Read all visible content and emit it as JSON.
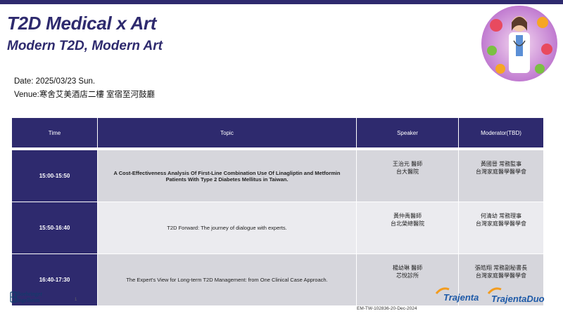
{
  "header": {
    "title": "T2D Medical x Art",
    "subtitle": "Modern T2D, Modern Art"
  },
  "event": {
    "date": "Date: 2025/03/23 Sun.",
    "venue": "Venue:寒舍艾美酒店二樓 室宿至河鼓廳"
  },
  "table": {
    "columns": [
      "Time",
      "Topic",
      "Speaker",
      "Moderator(TBD)"
    ],
    "rows": [
      {
        "time": "15:00-15:50",
        "topic": "A Cost-Effectiveness Analysis Of First-Line Combination Use Of Linagliptin and Metformin Patients With Type 2 Diabetes Mellitus in Taiwan.",
        "speaker_name": "王治元 醫師",
        "speaker_org": "台大醫院",
        "moderator_name": "黃國晉 常務監事",
        "moderator_org": "台灣家庭醫學醫學會"
      },
      {
        "time": "15:50-16:40",
        "topic": "T2D Forward: The journey of dialogue with experts.",
        "speaker_name": "黃仲禹醫師",
        "speaker_org": "台北榮總醫院",
        "moderator_name": "何清幼 常務理事",
        "moderator_org": "台灣家庭醫學醫學會"
      },
      {
        "time": "16:40-17:30",
        "topic": "The Expert's View for Long-term T2D Management: from One Clinical Case Approach.",
        "speaker_name": "楊幼琳 醫師",
        "speaker_org": "芯悅診所",
        "moderator_name": "張皓翔 常務副秘書長",
        "moderator_org": "台灣家庭醫學醫學會"
      }
    ]
  },
  "footer": {
    "company_line1": "Boehringer",
    "company_line2": "Ingelheim",
    "page_number": "1",
    "doc_number": "EM-TW-102836-20-Dec-2024",
    "brand1": "Trajenta",
    "brand2": "TrajentaDuo"
  },
  "colors": {
    "primary": "#2e2a6e",
    "row_alt1": "#d6d6dc",
    "row_alt2": "#ebebef",
    "trajenta_blue": "#1e5aa8",
    "trajenta_orange": "#f39c1e"
  }
}
